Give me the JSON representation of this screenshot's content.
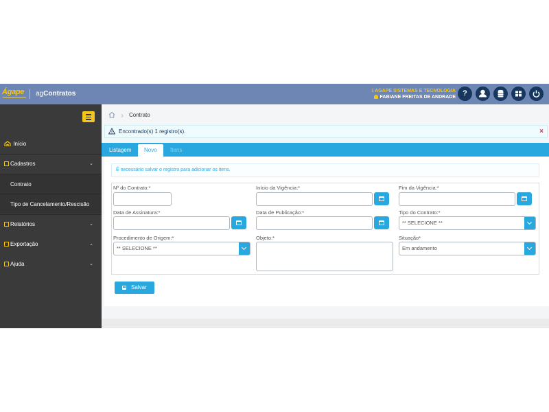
{
  "header": {
    "logo_text": "Ágape",
    "app_name_prefix": "ag",
    "app_name_bold": "Contratos",
    "company": "AGAPE SISTEMAS E TECNOLOGIA",
    "user": "FABIANE FREITAS DE ANDRADE",
    "buttons": [
      {
        "icon": "help-icon",
        "label": "?"
      },
      {
        "icon": "user-icon",
        "label": ""
      },
      {
        "icon": "database-icon",
        "label": ""
      },
      {
        "icon": "modules-icon",
        "label": ""
      },
      {
        "icon": "power-icon",
        "label": ""
      }
    ]
  },
  "sidebar": {
    "items": [
      {
        "label": "Início",
        "icon": "home-icon"
      },
      {
        "label": "Cadastros",
        "icon": "folder-icon",
        "expanded": true
      },
      {
        "label": "Contrato"
      },
      {
        "label": "Tipo de Cancelamento/Rescisão"
      },
      {
        "label": "Relatórios",
        "icon": "folder-icon"
      },
      {
        "label": "Exportação",
        "icon": "folder-icon"
      },
      {
        "label": "Ajuda",
        "icon": "folder-icon"
      }
    ]
  },
  "breadcrumb": {
    "current": "Contrato"
  },
  "alert": {
    "message": "Encontrado(s) 1 registro(s).",
    "close": "×"
  },
  "tabs": [
    {
      "label": "Listagem",
      "state": "normal"
    },
    {
      "label": "Novo",
      "state": "active"
    },
    {
      "label": "Itens",
      "state": "disabled"
    }
  ],
  "form": {
    "info": "É necessário salvar o registro para adicionar os itens.",
    "numero_contrato": {
      "label": "Nº do Contrato:*",
      "value": ""
    },
    "inicio_vigencia": {
      "label": "Início da Vigência:*",
      "value": ""
    },
    "fim_vigencia": {
      "label": "Fim da Vigência:*",
      "value": ""
    },
    "data_assinatura": {
      "label": "Data de Assinatura:*",
      "value": ""
    },
    "data_publicacao": {
      "label": "Data de Publicação:*",
      "value": ""
    },
    "tipo_contrato": {
      "label": "Tipo do Contrato:*",
      "value": "** SELECIONE **"
    },
    "procedimento_origem": {
      "label": "Procedimento de Origem:*",
      "value": "** SELECIONE **"
    },
    "objeto": {
      "label": "Objeto:*",
      "value": ""
    },
    "situacao": {
      "label": "Situação*",
      "value": "Em andamento"
    },
    "save_label": "Salvar"
  },
  "colors": {
    "primary": "#29a8e0",
    "header": "#6d86b3",
    "sidebar": "#3a3a3a",
    "accent": "#f5c518",
    "navy": "#17375e"
  }
}
